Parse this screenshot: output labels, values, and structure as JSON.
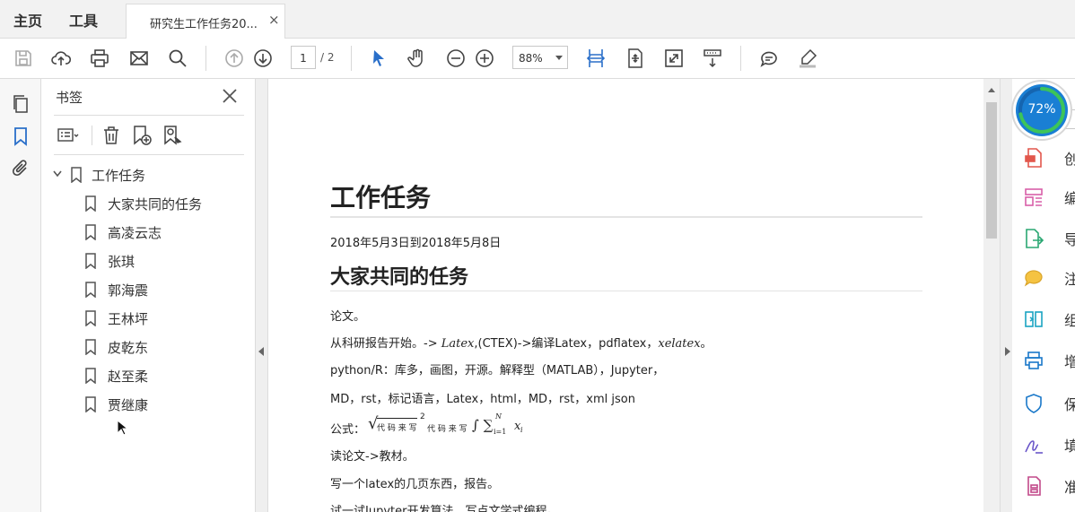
{
  "menu": {
    "home": "主页",
    "tools": "工具"
  },
  "tab": {
    "title": "研究生工作任务20...",
    "close": "×"
  },
  "toolbar": {
    "page_current": "1",
    "page_total": "/ 2",
    "zoom": "88%"
  },
  "bookmarks": {
    "title": "书签",
    "root": "工作任务",
    "items": [
      "大家共同的任务",
      "高凌云志",
      "张琪",
      "郭海震",
      "王林坪",
      "皮乾东",
      "赵至柔",
      "贾继康"
    ]
  },
  "document": {
    "title": "工作任务",
    "date": "2018年5月3日到2018年5月8日",
    "section": "大家共同的任务",
    "line1": "论文。",
    "line2a": "从科研报告开始。-> ",
    "line2_math": "Latex",
    "line2b": ",(CTEX)->编译Latex，pdflatex，",
    "line2_math2": "xelatex",
    "line2c": "。",
    "line3": "python/R：库多，画图，开源。解释型（MATLAB），Jupyter，",
    "line4": "MD，rst，标记语言，Latex，html，MD，rst，xml json",
    "line5_label": "公式：",
    "line5_radical": "代 码 来 写",
    "line5_sup": "2",
    "line5_mid": "代 码 来 写",
    "line5_sum": "∫ ∑",
    "line5_sum_upper": "N",
    "line5_sum_lower": "i=1",
    "line5_var": "x",
    "line5_var_sub": "i",
    "line6": "读论文->教材。",
    "line7": "写一个latex的几页东西，报告。",
    "line8": "试一试Jupyter开发算法，写点文学式编程。"
  },
  "right_panel": {
    "gauge_percent": "72%",
    "gauge_value": 0.72,
    "items": [
      "创",
      "编",
      "导",
      "注",
      "组",
      "增",
      "保",
      "填",
      "准"
    ]
  },
  "colors": {
    "accent_blue": "#1a7fd4",
    "icon_blue": "#2a6fc9",
    "gauge_green": "#3cc45a"
  }
}
